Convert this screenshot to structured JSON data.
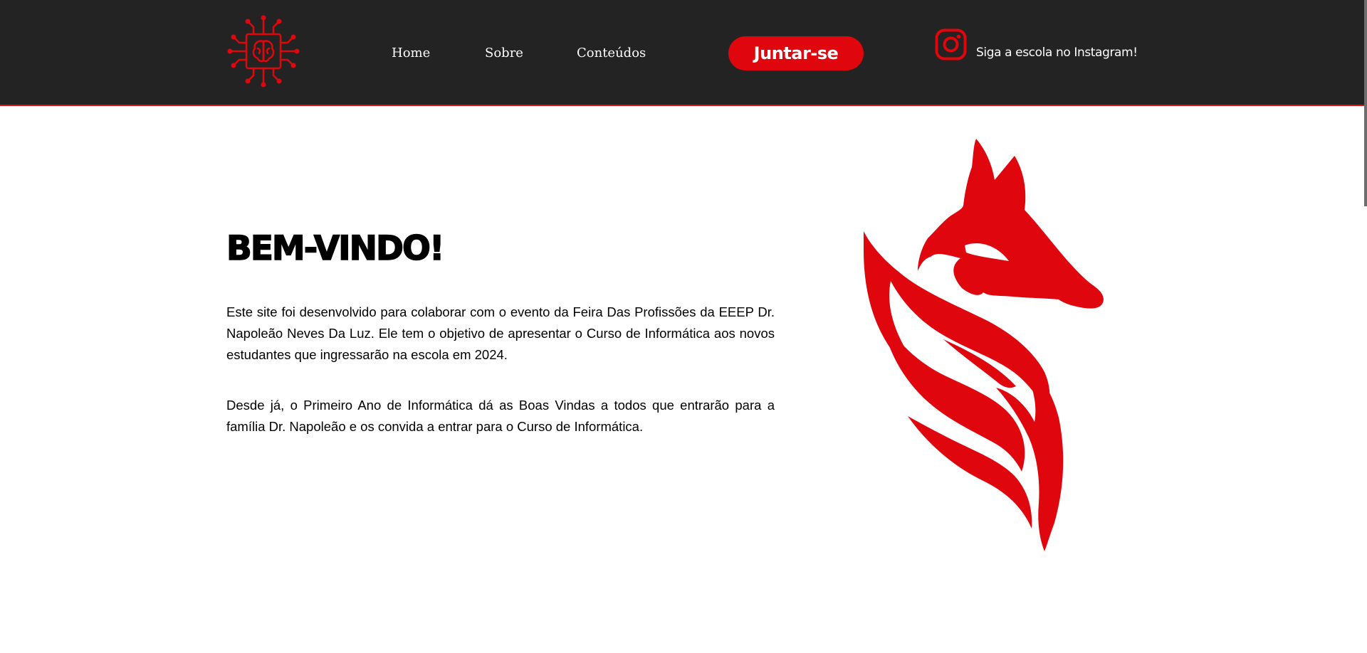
{
  "header": {
    "nav": [
      {
        "label": "Home"
      },
      {
        "label": "Sobre"
      },
      {
        "label": "Conteúdos"
      }
    ],
    "join_label": "Juntar-se",
    "instagram_label": "Siga a escola no Instagram!",
    "logo_icon": "circuit-brain-icon"
  },
  "main": {
    "title": "BEM-VINDO!",
    "paragraphs": [
      "Este site foi desenvolvido para colaborar com o evento da Feira Das Profissões da EEEP Dr. Napoleão Neves Da Luz. Ele tem o objetivo de apresentar o Curso de Informática aos novos estudantes que ingressarão na escola em 2024.",
      "Desde já, o Primeiro Ano de Informática dá as Boas Vindas a todos que entrarão para a família Dr. Napoleão e os convida a entrar para o Curso de Informática."
    ],
    "mascot": "red-fox-illustration"
  },
  "colors": {
    "header_bg": "#232323",
    "accent": "#e0060d",
    "text": "#000000"
  }
}
